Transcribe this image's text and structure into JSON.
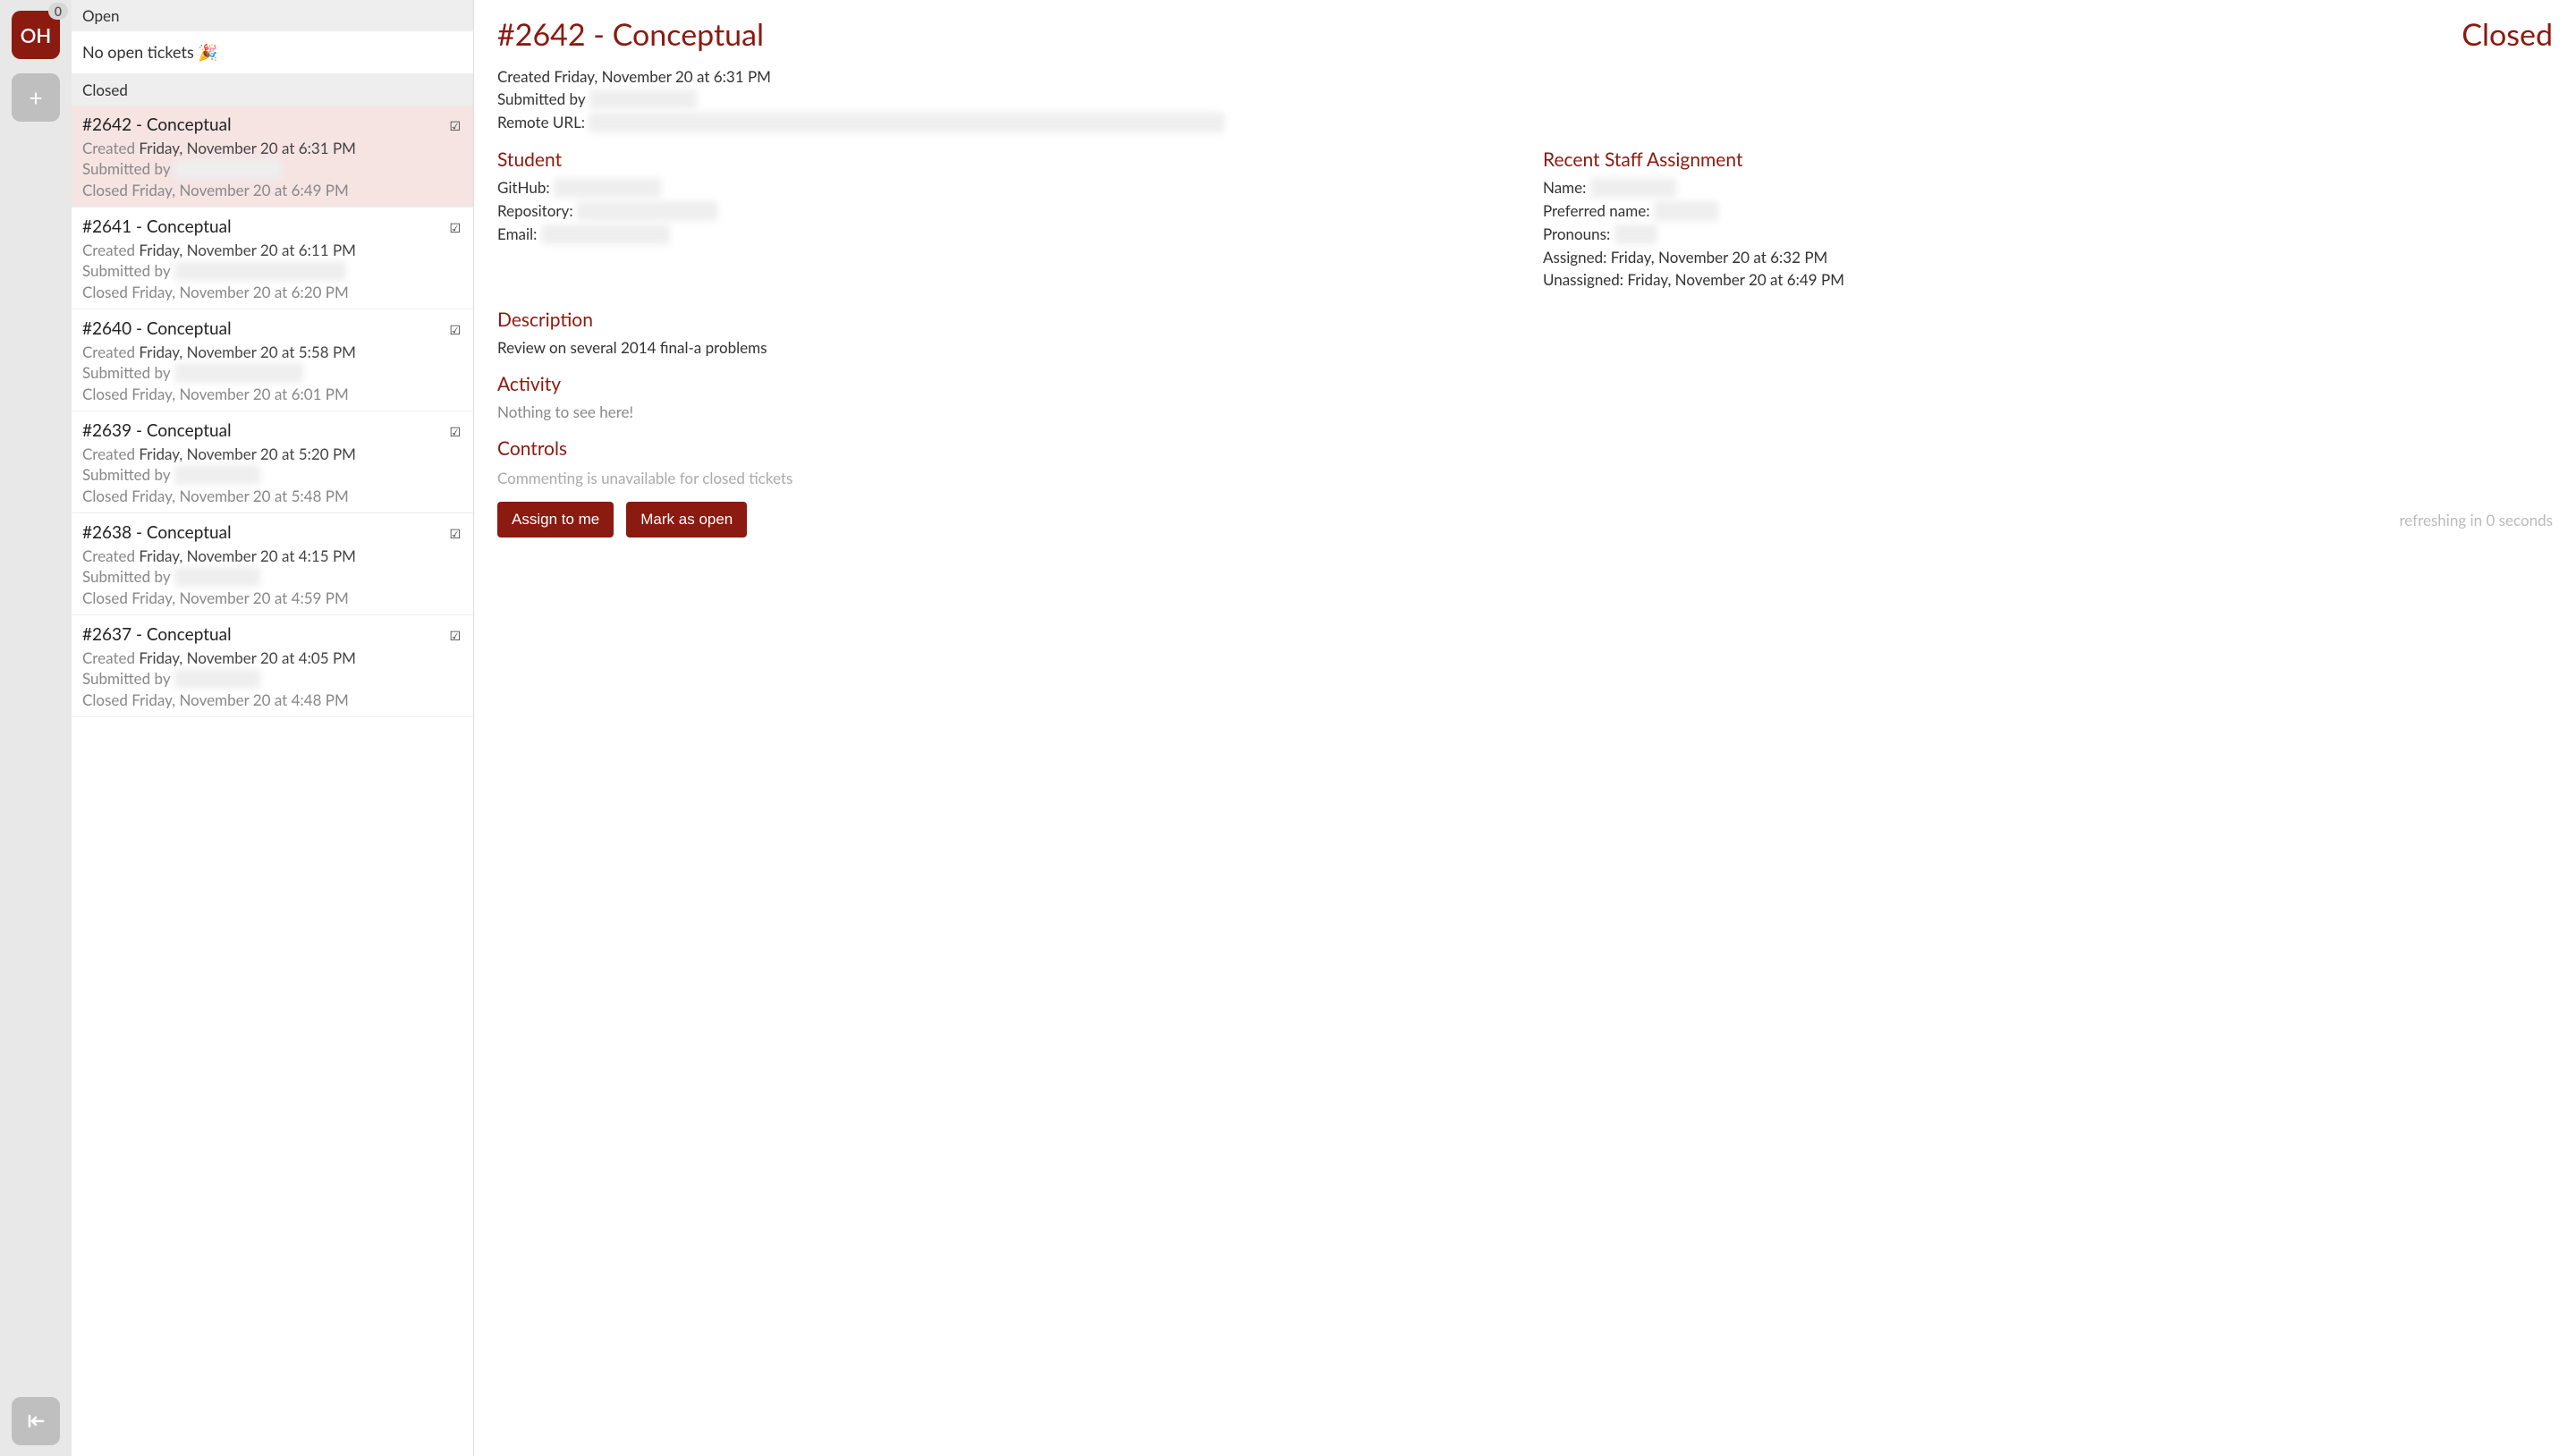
{
  "rail": {
    "oh_label": "OH",
    "oh_badge": "0",
    "add_label": "+"
  },
  "list": {
    "open_header": "Open",
    "open_empty": "No open tickets 🎉",
    "closed_header": "Closed",
    "tickets": [
      {
        "title": "#2642 - Conceptual",
        "created_label": "Created",
        "created": "Friday, November 20 at 6:31 PM",
        "submitted_label": "Submitted by",
        "submitted_redacted": "██████████",
        "closed": "Closed Friday, November 20 at 6:49 PM",
        "check": "☑",
        "selected": true
      },
      {
        "title": "#2641 - Conceptual",
        "created_label": "Created",
        "created": "Friday, November 20 at 6:11 PM",
        "submitted_label": "Submitted by",
        "submitted_redacted": "████████████████",
        "closed": "Closed Friday, November 20 at 6:20 PM",
        "check": "☑",
        "selected": false
      },
      {
        "title": "#2640 - Conceptual",
        "created_label": "Created",
        "created": "Friday, November 20 at 5:58 PM",
        "submitted_label": "Submitted by",
        "submitted_redacted": "████████████",
        "closed": "Closed Friday, November 20 at 6:01 PM",
        "check": "☑",
        "selected": false
      },
      {
        "title": "#2639 - Conceptual",
        "created_label": "Created",
        "created": "Friday, November 20 at 5:20 PM",
        "submitted_label": "Submitted by",
        "submitted_redacted": "████████",
        "closed": "Closed Friday, November 20 at 5:48 PM",
        "check": "☑",
        "selected": false
      },
      {
        "title": "#2638 - Conceptual",
        "created_label": "Created",
        "created": "Friday, November 20 at 4:15 PM",
        "submitted_label": "Submitted by",
        "submitted_redacted": "████████",
        "closed": "Closed Friday, November 20 at 4:59 PM",
        "check": "☑",
        "selected": false
      },
      {
        "title": "#2637 - Conceptual",
        "created_label": "Created",
        "created": "Friday, November 20 at 4:05 PM",
        "submitted_label": "Submitted by",
        "submitted_redacted": "████████",
        "closed": "Closed Friday, November 20 at 4:48 PM",
        "check": "☑",
        "selected": false
      }
    ]
  },
  "detail": {
    "title": "#2642 - Conceptual",
    "status": "Closed",
    "created_line": "Created Friday, November 20 at 6:31 PM",
    "submitted_label": "Submitted by",
    "submitted_redacted": "██████████",
    "remote_label": "Remote URL:",
    "remote_redacted": "███████████████████████████████████████████████████████████",
    "student": {
      "heading": "Student",
      "github_label": "GitHub:",
      "github_redacted": "██████████",
      "repo_label": "Repository:",
      "repo_redacted": "█████████████",
      "email_label": "Email:",
      "email_redacted": "████████████"
    },
    "staff": {
      "heading": "Recent Staff Assignment",
      "name_label": "Name:",
      "name_redacted": "████████",
      "pref_label": "Preferred name:",
      "pref_redacted": "██████",
      "pronouns_label": "Pronouns:",
      "pronouns_redacted": "████",
      "assigned": "Assigned: Friday, November 20 at 6:32 PM",
      "unassigned": "Unassigned: Friday, November 20 at 6:49 PM"
    },
    "description_heading": "Description",
    "description": "Review on several 2014 final-a problems",
    "activity_heading": "Activity",
    "activity_empty": "Nothing to see here!",
    "controls_heading": "Controls",
    "comment_disabled": "Commenting is unavailable for closed tickets",
    "assign_btn": "Assign to me",
    "open_btn": "Mark as open",
    "refresh_note": "refreshing in 0 seconds"
  }
}
